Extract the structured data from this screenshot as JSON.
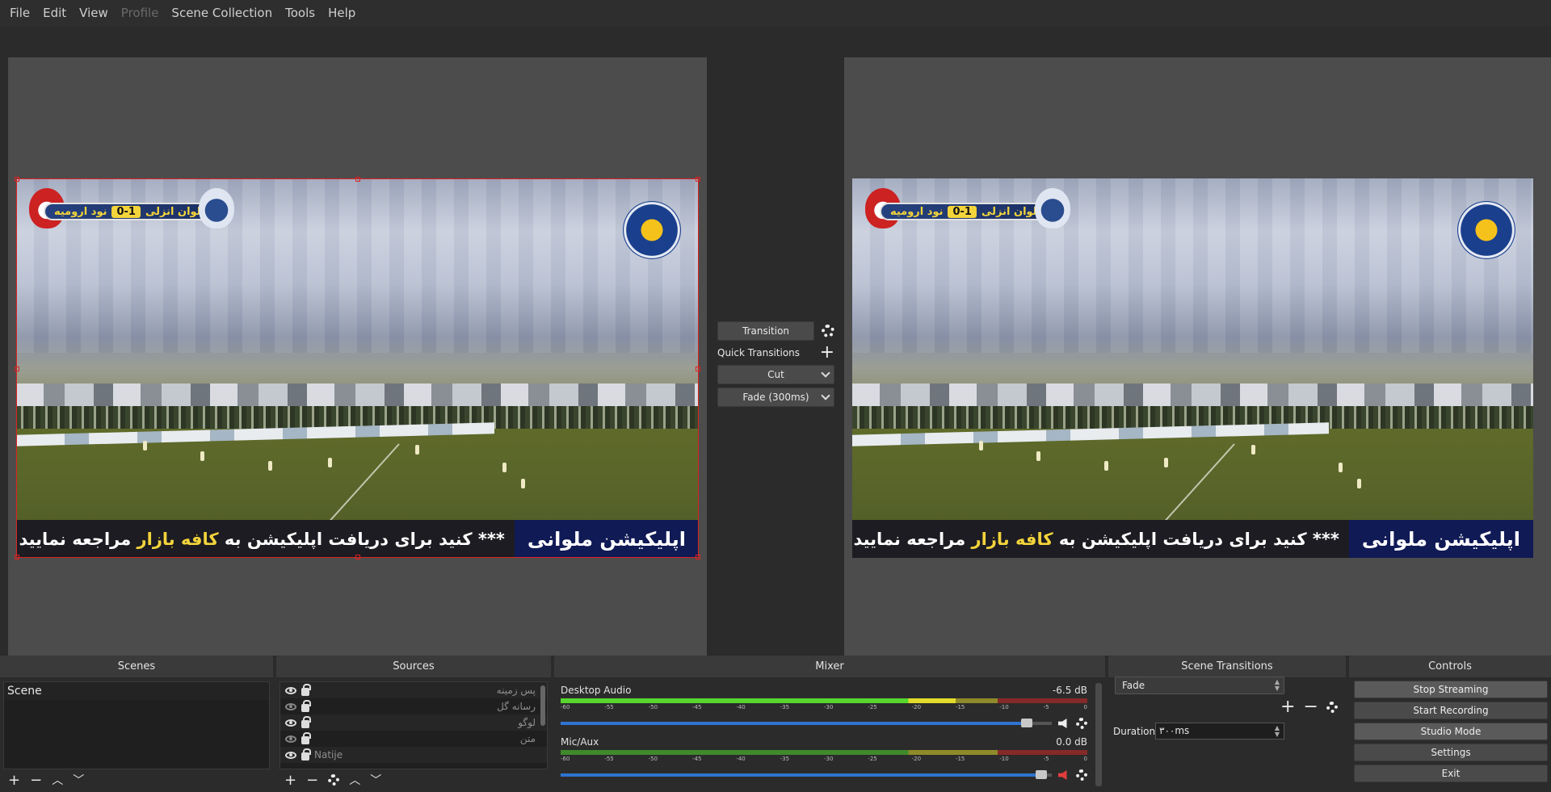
{
  "menu": {
    "items": [
      "File",
      "Edit",
      "View",
      "Profile",
      "Scene Collection",
      "Tools",
      "Help"
    ],
    "disabled": [
      "Profile"
    ]
  },
  "video": {
    "score_team_home": "ملوان انزلی",
    "score_value": "0-1",
    "score_team_away": "نود ارومیه",
    "ticker_brand": "اپلیکیشن ملوانی",
    "ticker_prefix": "مراجعه نمایید",
    "ticker_highlight": "کافه بازار",
    "ticker_suffix": "برای دریافت اپلیکیشن به",
    "ticker_tail": "*** کنید"
  },
  "transition": {
    "button_label": "Transition",
    "quick_label": "Quick Transitions",
    "cut_label": "Cut",
    "fade_label": "Fade (300ms)"
  },
  "docks": {
    "scenes_title": "Scenes",
    "sources_title": "Sources",
    "mixer_title": "Mixer",
    "scene_transitions_title": "Scene Transitions",
    "controls_title": "Controls"
  },
  "scenes": {
    "items": [
      {
        "label": "Scene"
      }
    ]
  },
  "sources": {
    "items": [
      {
        "label": "پس زمینه",
        "visible": true
      },
      {
        "label": "رسانه گل",
        "visible": false
      },
      {
        "label": "لوگو",
        "visible": true
      },
      {
        "label": "متن",
        "visible": false
      },
      {
        "label": "Natije",
        "visible": true
      }
    ]
  },
  "mixer": {
    "channels": [
      {
        "name": "Desktop Audio",
        "level": "-6.5 dB",
        "volume": 0.96,
        "muted": false
      },
      {
        "name": "Mic/Aux",
        "level": "0.0 dB",
        "volume": 0.99,
        "muted": true
      }
    ],
    "ticks": [
      "-60",
      "-55",
      "-50",
      "-45",
      "-40",
      "-35",
      "-30",
      "-25",
      "-20",
      "-15",
      "-10",
      "-5",
      "0"
    ]
  },
  "scene_transitions": {
    "selected": "Fade",
    "duration_label": "Duration",
    "duration_value": "۳۰۰ms"
  },
  "controls": {
    "stop_streaming": "Stop Streaming",
    "start_recording": "Start Recording",
    "studio_mode": "Studio Mode",
    "settings": "Settings",
    "exit": "Exit"
  }
}
